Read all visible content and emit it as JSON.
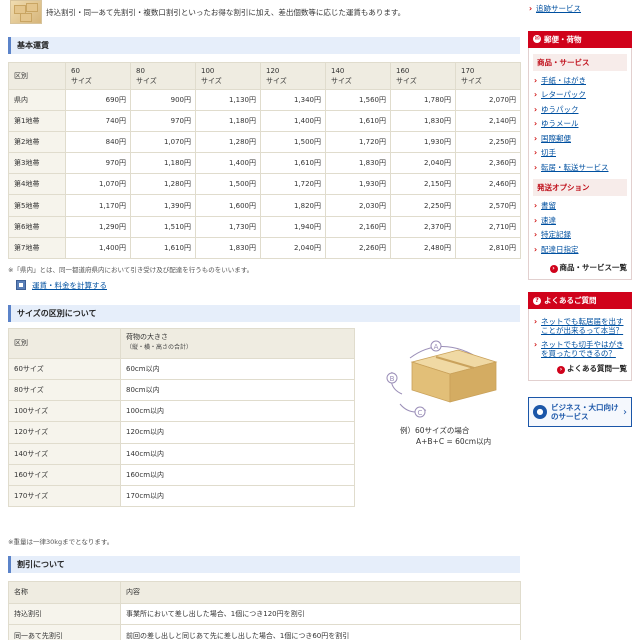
{
  "intro": {
    "text": "持込割引・同一あて先割引・複数口割引といったお得な割引に加え、差出個数等に応じた運賃もあります。"
  },
  "basic_rates": {
    "title": "基本運賃",
    "corner": "区別",
    "sizes": [
      {
        "num": "60",
        "unit": "サイズ"
      },
      {
        "num": "80",
        "unit": "サイズ"
      },
      {
        "num": "100",
        "unit": "サイズ"
      },
      {
        "num": "120",
        "unit": "サイズ"
      },
      {
        "num": "140",
        "unit": "サイズ"
      },
      {
        "num": "160",
        "unit": "サイズ"
      },
      {
        "num": "170",
        "unit": "サイズ"
      }
    ],
    "rows": [
      {
        "zone": "県内",
        "prices": [
          "690円",
          "900円",
          "1,130円",
          "1,340円",
          "1,560円",
          "1,780円",
          "2,070円"
        ]
      },
      {
        "zone": "第1地帯",
        "prices": [
          "740円",
          "970円",
          "1,180円",
          "1,400円",
          "1,610円",
          "1,830円",
          "2,140円"
        ]
      },
      {
        "zone": "第2地帯",
        "prices": [
          "840円",
          "1,070円",
          "1,280円",
          "1,500円",
          "1,720円",
          "1,930円",
          "2,250円"
        ]
      },
      {
        "zone": "第3地帯",
        "prices": [
          "970円",
          "1,180円",
          "1,400円",
          "1,610円",
          "1,830円",
          "2,040円",
          "2,360円"
        ]
      },
      {
        "zone": "第4地帯",
        "prices": [
          "1,070円",
          "1,280円",
          "1,500円",
          "1,720円",
          "1,930円",
          "2,150円",
          "2,460円"
        ]
      },
      {
        "zone": "第5地帯",
        "prices": [
          "1,170円",
          "1,390円",
          "1,600円",
          "1,820円",
          "2,030円",
          "2,250円",
          "2,570円"
        ]
      },
      {
        "zone": "第6地帯",
        "prices": [
          "1,290円",
          "1,510円",
          "1,730円",
          "1,940円",
          "2,160円",
          "2,370円",
          "2,710円"
        ]
      },
      {
        "zone": "第7地帯",
        "prices": [
          "1,400円",
          "1,610円",
          "1,830円",
          "2,040円",
          "2,260円",
          "2,480円",
          "2,810円"
        ]
      }
    ],
    "note": "※「県内」とは、同一都道府県内において引き受け及び配達を行うものをいいます。",
    "calc_link": "運賃・料金を計算する"
  },
  "size_section": {
    "title": "サイズの区別について",
    "col1": "区別",
    "col2": "荷物の大きさ",
    "col2_sub": "（縦・横・高さの合計）",
    "rows": [
      {
        "label": "60サイズ",
        "value": "60cm以内"
      },
      {
        "label": "80サイズ",
        "value": "80cm以内"
      },
      {
        "label": "100サイズ",
        "value": "100cm以内"
      },
      {
        "label": "120サイズ",
        "value": "120cm以内"
      },
      {
        "label": "140サイズ",
        "value": "140cm以内"
      },
      {
        "label": "160サイズ",
        "value": "160cm以内"
      },
      {
        "label": "170サイズ",
        "value": "170cm以内"
      }
    ],
    "box_labels": {
      "a": "A",
      "b": "B",
      "c": "C"
    },
    "caption_line1": "例）60サイズの場合",
    "caption_line2": "A+B+C = 60cm以内",
    "note": "※重量は一律30kgまでとなります。"
  },
  "discount_section": {
    "title": "割引について",
    "col1": "名称",
    "col2": "内容",
    "rows": [
      {
        "name": "持込割引",
        "content": "事業所において差し出した場合、1個につき120円を割引"
      },
      {
        "name": "同一あて先割引",
        "content": "前回の差し出しと同じあて先に差し出した場合、1個につき60円を割引"
      },
      {
        "name": "複数口割引",
        "content": "同じあて先に複数個差し出した場合、1個につき60円を割引"
      }
    ]
  },
  "sidebar": {
    "top_link": "追跡サービス",
    "mail_panel": {
      "header": "郵便・荷物",
      "cat1": "商品・サービス",
      "items1": [
        "手紙・はがき",
        "レターパック",
        "ゆうパック",
        "ゆうメール",
        "国際郵便",
        "切手",
        "転居・転送サービス"
      ],
      "cat2": "発送オプション",
      "items2": [
        "書留",
        "速達",
        "特定記録",
        "配達日指定"
      ],
      "more": "商品・サービス一覧"
    },
    "faq_panel": {
      "header": "よくあるご質問",
      "items": [
        "ネットでも転居届を出すことが出来るって本当？",
        "ネットでも切手やはがきを買ったりできるの？"
      ],
      "more": "よくある質問一覧"
    },
    "business": {
      "line1": "ビジネス・大口向け",
      "line2": "のサービス"
    }
  },
  "colors": {
    "accent_red": "#d0021b",
    "link_blue": "#0050a0",
    "header_bg": "#e6eefa",
    "table_head_bg": "#efece1"
  }
}
